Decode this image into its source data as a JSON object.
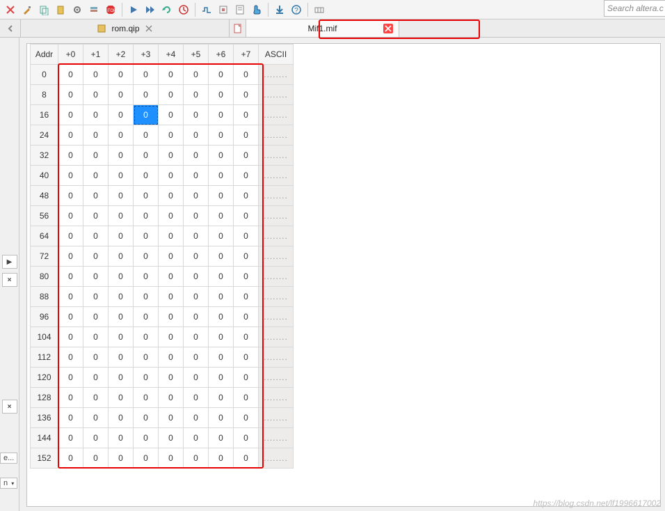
{
  "search": {
    "placeholder": "Search altera.c"
  },
  "tabs": [
    {
      "label": "rom.qip",
      "icon": "chip-icon",
      "active": false
    },
    {
      "label": "Mif1.mif",
      "icon": "file-icon",
      "active": true,
      "highlighted": true
    }
  ],
  "mem_header": {
    "addr": "Addr",
    "cols": [
      "+0",
      "+1",
      "+2",
      "+3",
      "+4",
      "+5",
      "+6",
      "+7"
    ],
    "ascii": "ASCII"
  },
  "rows": [
    {
      "addr": "0",
      "v": [
        "0",
        "0",
        "0",
        "0",
        "0",
        "0",
        "0",
        "0"
      ],
      "ascii": "........"
    },
    {
      "addr": "8",
      "v": [
        "0",
        "0",
        "0",
        "0",
        "0",
        "0",
        "0",
        "0"
      ],
      "ascii": "........"
    },
    {
      "addr": "16",
      "v": [
        "0",
        "0",
        "0",
        "0",
        "0",
        "0",
        "0",
        "0"
      ],
      "ascii": "........",
      "sel": 3
    },
    {
      "addr": "24",
      "v": [
        "0",
        "0",
        "0",
        "0",
        "0",
        "0",
        "0",
        "0"
      ],
      "ascii": "........"
    },
    {
      "addr": "32",
      "v": [
        "0",
        "0",
        "0",
        "0",
        "0",
        "0",
        "0",
        "0"
      ],
      "ascii": "........"
    },
    {
      "addr": "40",
      "v": [
        "0",
        "0",
        "0",
        "0",
        "0",
        "0",
        "0",
        "0"
      ],
      "ascii": "........"
    },
    {
      "addr": "48",
      "v": [
        "0",
        "0",
        "0",
        "0",
        "0",
        "0",
        "0",
        "0"
      ],
      "ascii": "........"
    },
    {
      "addr": "56",
      "v": [
        "0",
        "0",
        "0",
        "0",
        "0",
        "0",
        "0",
        "0"
      ],
      "ascii": "........"
    },
    {
      "addr": "64",
      "v": [
        "0",
        "0",
        "0",
        "0",
        "0",
        "0",
        "0",
        "0"
      ],
      "ascii": "........"
    },
    {
      "addr": "72",
      "v": [
        "0",
        "0",
        "0",
        "0",
        "0",
        "0",
        "0",
        "0"
      ],
      "ascii": "........"
    },
    {
      "addr": "80",
      "v": [
        "0",
        "0",
        "0",
        "0",
        "0",
        "0",
        "0",
        "0"
      ],
      "ascii": "........"
    },
    {
      "addr": "88",
      "v": [
        "0",
        "0",
        "0",
        "0",
        "0",
        "0",
        "0",
        "0"
      ],
      "ascii": "........"
    },
    {
      "addr": "96",
      "v": [
        "0",
        "0",
        "0",
        "0",
        "0",
        "0",
        "0",
        "0"
      ],
      "ascii": "........"
    },
    {
      "addr": "104",
      "v": [
        "0",
        "0",
        "0",
        "0",
        "0",
        "0",
        "0",
        "0"
      ],
      "ascii": "........"
    },
    {
      "addr": "112",
      "v": [
        "0",
        "0",
        "0",
        "0",
        "0",
        "0",
        "0",
        "0"
      ],
      "ascii": "........"
    },
    {
      "addr": "120",
      "v": [
        "0",
        "0",
        "0",
        "0",
        "0",
        "0",
        "0",
        "0"
      ],
      "ascii": "........"
    },
    {
      "addr": "128",
      "v": [
        "0",
        "0",
        "0",
        "0",
        "0",
        "0",
        "0",
        "0"
      ],
      "ascii": "........"
    },
    {
      "addr": "136",
      "v": [
        "0",
        "0",
        "0",
        "0",
        "0",
        "0",
        "0",
        "0"
      ],
      "ascii": "........"
    },
    {
      "addr": "144",
      "v": [
        "0",
        "0",
        "0",
        "0",
        "0",
        "0",
        "0",
        "0"
      ],
      "ascii": "........"
    },
    {
      "addr": "152",
      "v": [
        "0",
        "0",
        "0",
        "0",
        "0",
        "0",
        "0",
        "0"
      ],
      "ascii": "........"
    }
  ],
  "left_buttons": {
    "arrow": "▶",
    "close": "×",
    "e_label": "e...",
    "n_label": "n"
  },
  "watermark": "https://blog.csdn.net/lf1996617002"
}
